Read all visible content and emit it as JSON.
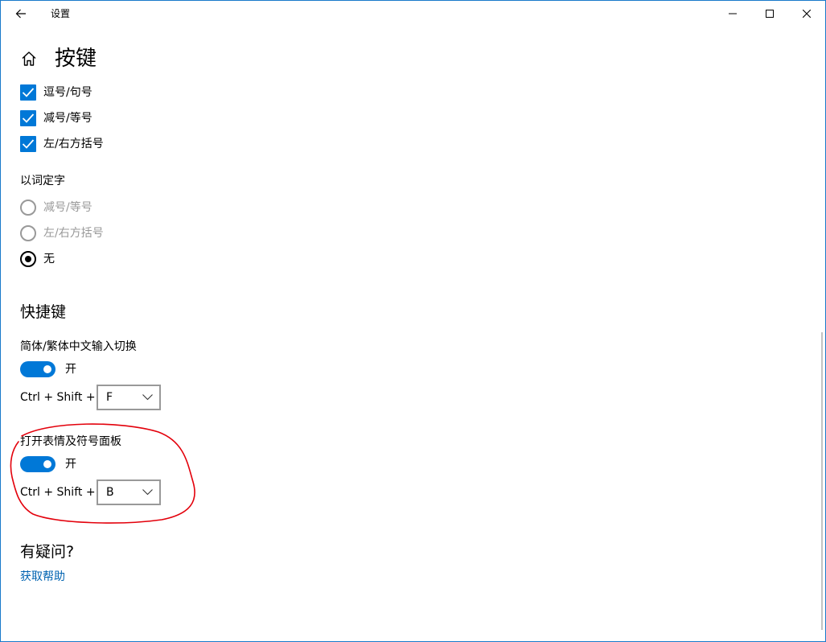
{
  "window": {
    "title": "设置",
    "colors": {
      "accent": "#0078d7",
      "border": "#1979ca",
      "link": "#0063b1",
      "annotation": "#e3000b"
    }
  },
  "header": {
    "title": "按键",
    "icon": "home-icon"
  },
  "checkboxes": [
    {
      "label": "逗号/句号",
      "checked": true
    },
    {
      "label": "减号/等号",
      "checked": true
    },
    {
      "label": "左/右方括号",
      "checked": true
    }
  ],
  "word_select": {
    "label": "以词定字",
    "options": [
      {
        "label": "减号/等号",
        "selected": false,
        "enabled": false
      },
      {
        "label": "左/右方括号",
        "selected": false,
        "enabled": false
      },
      {
        "label": "无",
        "selected": true,
        "enabled": true
      }
    ]
  },
  "shortcuts": {
    "heading": "快捷键",
    "items": [
      {
        "label": "简体/繁体中文输入切换",
        "toggle_state": "开",
        "toggle_on": true,
        "combo_prefix": "Ctrl + Shift +",
        "key": "F"
      },
      {
        "label": "打开表情及符号面板",
        "toggle_state": "开",
        "toggle_on": true,
        "combo_prefix": "Ctrl + Shift +",
        "key": "B"
      }
    ]
  },
  "help": {
    "heading": "有疑问?",
    "link": "获取帮助"
  }
}
